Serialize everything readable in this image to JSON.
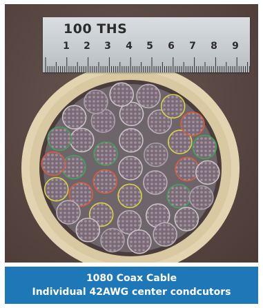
{
  "ruler": {
    "title": "100 THS",
    "numbers": [
      "1",
      "2",
      "3",
      "4",
      "5",
      "6",
      "7",
      "8",
      "9"
    ]
  },
  "caption": {
    "line1": "1080 Coax Cable",
    "line2": "Individual 42AWG center condcutors"
  },
  "colors": {
    "caption_bg": "#1e78b8",
    "caption_text": "#ffffff",
    "photo_bg": "#5b4a45",
    "jacket": "#e2d3b0"
  }
}
